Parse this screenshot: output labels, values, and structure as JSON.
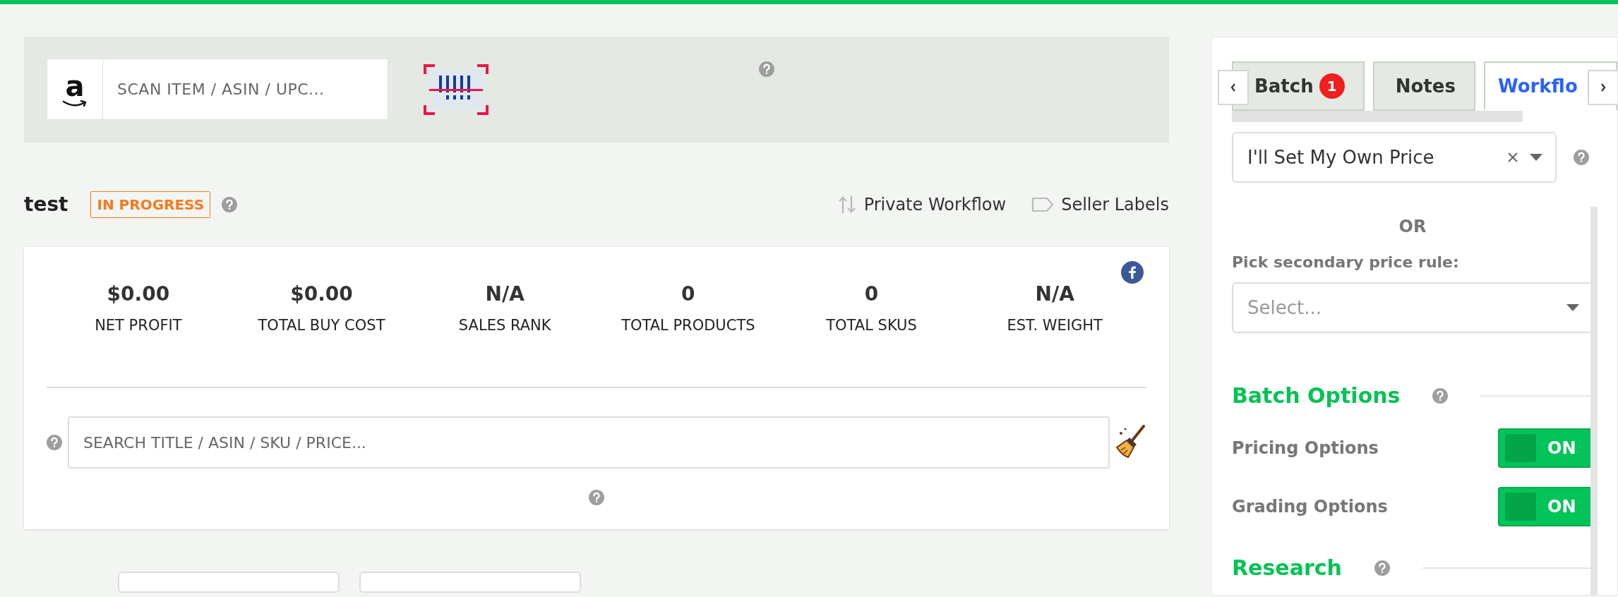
{
  "scan": {
    "logo": "a",
    "placeholder": "SCAN ITEM / ASIN / UPC..."
  },
  "batch": {
    "name": "test",
    "status": "IN PROGRESS",
    "links": [
      {
        "label": "Private Workflow",
        "kind": "workflow"
      },
      {
        "label": "Seller Labels",
        "kind": "labels"
      }
    ]
  },
  "stats": [
    {
      "value": "$0.00",
      "label": "NET PROFIT"
    },
    {
      "value": "$0.00",
      "label": "TOTAL BUY COST"
    },
    {
      "value": "N/A",
      "label": "SALES RANK"
    },
    {
      "value": "0",
      "label": "TOTAL PRODUCTS"
    },
    {
      "value": "0",
      "label": "TOTAL SKUS"
    },
    {
      "value": "N/A",
      "label": "EST. WEIGHT"
    }
  ],
  "search": {
    "placeholder": "SEARCH TITLE / ASIN / SKU / PRICE..."
  },
  "bottom_buttons": [
    {
      "kind": "outline"
    },
    {
      "kind": "outline"
    }
  ],
  "panel": {
    "tabs": [
      {
        "label": "Batch",
        "badge": "1",
        "selected": false
      },
      {
        "label": "Notes",
        "selected": false
      },
      {
        "label": "Workflo",
        "selected": true
      }
    ],
    "price_rule": {
      "value": "I'll Set My Own Price"
    },
    "or": "OR",
    "secondary_label": "Pick secondary price rule:",
    "secondary": {
      "placeholder": "Select..."
    },
    "sections": [
      {
        "title": "Batch Options",
        "options": [
          {
            "label": "Pricing Options",
            "on": true,
            "state_text": "ON"
          },
          {
            "label": "Grading Options",
            "on": true,
            "state_text": "ON"
          }
        ]
      },
      {
        "title": "Research"
      }
    ]
  }
}
